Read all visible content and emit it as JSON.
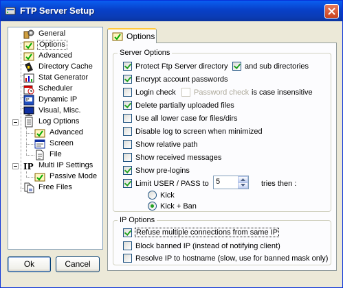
{
  "window": {
    "title": "FTP Server Setup"
  },
  "tree": {
    "items": [
      {
        "label": "General",
        "icon": "general-icon"
      },
      {
        "label": "Options",
        "icon": "options-icon"
      },
      {
        "label": "Advanced",
        "icon": "advanced-icon"
      },
      {
        "label": "Directory Cache",
        "icon": "directory-cache-icon"
      },
      {
        "label": "Stat Generator",
        "icon": "stat-generator-icon"
      },
      {
        "label": "Scheduler",
        "icon": "scheduler-icon"
      },
      {
        "label": "Dynamic IP",
        "icon": "dynamic-ip-icon"
      },
      {
        "label": "Visual, Misc.",
        "icon": "monitor-icon"
      },
      {
        "label": "Log Options",
        "icon": "log-options-icon"
      },
      {
        "label": "Advanced",
        "icon": "log-advanced-icon"
      },
      {
        "label": "Screen",
        "icon": "screen-icon"
      },
      {
        "label": "File",
        "icon": "file-icon"
      },
      {
        "label": "Multi IP Settings",
        "icon": "multi-ip-icon"
      },
      {
        "label": "Passive Mode",
        "icon": "passive-mode-icon"
      },
      {
        "label": "Free Files",
        "icon": "free-files-icon"
      }
    ]
  },
  "buttons": {
    "ok": "Ok",
    "cancel": "Cancel"
  },
  "tab": {
    "label": "Options"
  },
  "server_options": {
    "title": "Server Options",
    "protect_dir": {
      "label": "Protect Ftp Server directory",
      "checked": true
    },
    "sub_dirs": {
      "label": "and sub directories",
      "checked": true
    },
    "encrypt": {
      "label": "Encrypt account passwords",
      "checked": true
    },
    "login_check": {
      "label": "Login check",
      "checked": false
    },
    "password_check": {
      "label": "Password check",
      "checked": false,
      "disabled": true
    },
    "case_insensitive": "is case insensitive",
    "delete_partial": {
      "label": "Delete partially uploaded files",
      "checked": true
    },
    "lower_case": {
      "label": "Use all lower case for files/dirs",
      "checked": false
    },
    "disable_log": {
      "label": "Disable log to screen when minimized",
      "checked": false
    },
    "relative_path": {
      "label": "Show relative path",
      "checked": false
    },
    "received_messages": {
      "label": "Show received messages",
      "checked": false
    },
    "pre_logins": {
      "label": "Show pre-logins",
      "checked": true
    },
    "limit_userpass": {
      "label": "Limit USER / PASS to",
      "checked": true
    },
    "tries_value": "5",
    "tries_then": "tries then :",
    "kick": {
      "label": "Kick",
      "selected": false
    },
    "kick_ban": {
      "label": "Kick + Ban",
      "selected": true
    }
  },
  "ip_options": {
    "title": "IP Options",
    "refuse_multiple": {
      "label": "Refuse multiple connections from same IP",
      "checked": true
    },
    "block_banned": {
      "label": "Block banned IP (instead of notifying client)",
      "checked": false
    },
    "resolve_ip": {
      "label": "Resolve IP to hostname (slow, use for banned mask only)",
      "checked": false
    }
  },
  "colors": {
    "title_bar": "#0a5ef0",
    "window_bg": "#ece9d8",
    "check_green": "#21a121"
  }
}
